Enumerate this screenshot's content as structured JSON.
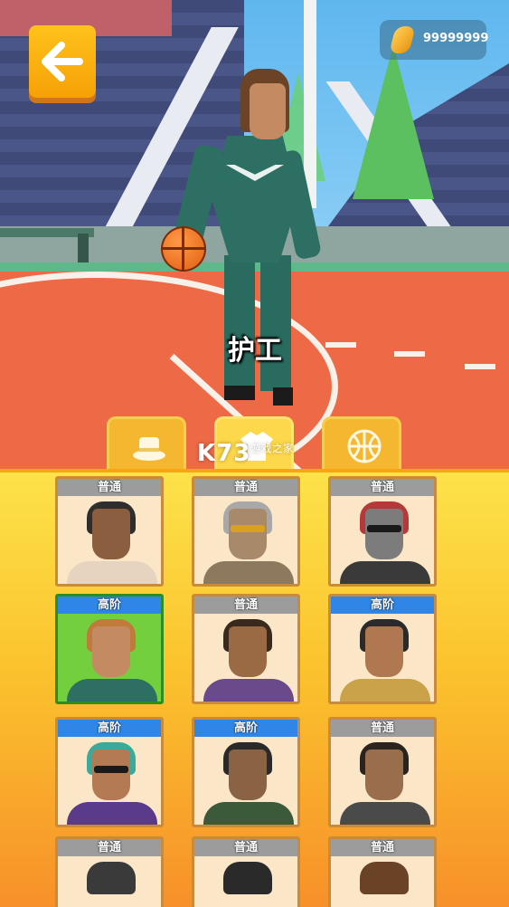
{
  "hud": {
    "back_icon": "arrow-left-icon",
    "coins": "99999999"
  },
  "character": {
    "name": "护工"
  },
  "tabs": [
    {
      "icon": "hat-icon",
      "active": false
    },
    {
      "icon": "shirt-icon",
      "active": true
    },
    {
      "icon": "basketball-icon",
      "active": false
    }
  ],
  "watermark": {
    "main": "K73",
    "sub": "游戏之家"
  },
  "cards": [
    {
      "tag": "普通",
      "rarity": "common",
      "selected": false
    },
    {
      "tag": "普通",
      "rarity": "common",
      "selected": false
    },
    {
      "tag": "普通",
      "rarity": "common",
      "selected": false
    },
    {
      "tag": "高阶",
      "rarity": "advanced",
      "selected": true
    },
    {
      "tag": "普通",
      "rarity": "common",
      "selected": false
    },
    {
      "tag": "高阶",
      "rarity": "advanced",
      "selected": false
    },
    {
      "tag": "高阶",
      "rarity": "advanced",
      "selected": false
    },
    {
      "tag": "高阶",
      "rarity": "advanced",
      "selected": false
    },
    {
      "tag": "普通",
      "rarity": "common",
      "selected": false
    },
    {
      "tag": "普通",
      "rarity": "common",
      "selected": false
    },
    {
      "tag": "普通",
      "rarity": "common",
      "selected": false
    },
    {
      "tag": "普通",
      "rarity": "common",
      "selected": false
    }
  ],
  "colors": {
    "accent": "#fbc32d",
    "tag_common": "#9c9c9c",
    "tag_advanced": "#2f86e6",
    "selected": "#73cf3e"
  }
}
